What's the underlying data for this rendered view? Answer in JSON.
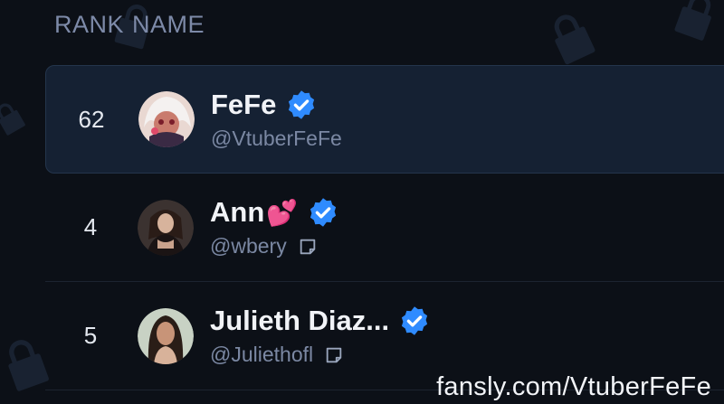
{
  "header": {
    "rank_label": "RANK",
    "name_label": "NAME"
  },
  "rows": [
    {
      "rank": "62",
      "name": "FeFe",
      "emoji": "",
      "handle": "@VtuberFeFe",
      "verified": true,
      "has_note": false,
      "selected": true,
      "avatar_icon": "avatar-anime-character"
    },
    {
      "rank": "4",
      "name": "Ann",
      "emoji": "💕",
      "handle": "@wbery",
      "verified": true,
      "has_note": true,
      "selected": false,
      "avatar_icon": "avatar-photo"
    },
    {
      "rank": "5",
      "name": "Julieth Diaz...",
      "emoji": "",
      "handle": "@Juliethofl",
      "verified": true,
      "has_note": true,
      "selected": false,
      "avatar_icon": "avatar-photo"
    }
  ],
  "watermark": "fansly.com/VtuberFeFe",
  "colors": {
    "accent": "#2f8bff",
    "background": "#0c1017",
    "selected_row": "#152133"
  }
}
